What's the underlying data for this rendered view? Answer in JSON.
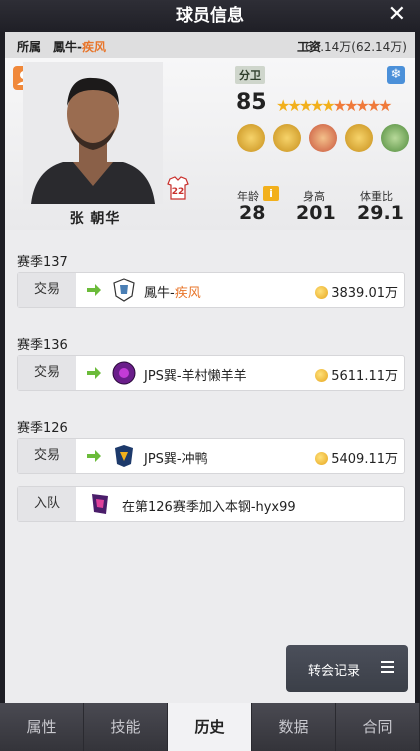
{
  "window": {
    "title": "球员信息"
  },
  "info": {
    "affiliation_label": "所属",
    "team_main": "鳳牛-",
    "team_sub": "疾风",
    "salary_label": "工资",
    "salary_value": "62.14万(62.14万)"
  },
  "player": {
    "name": "张 朝华",
    "position": "分卫",
    "overall": "85",
    "star_rating": 5,
    "jersey_number": "22",
    "stats": [
      {
        "label": "年龄",
        "value": "28"
      },
      {
        "label": "身高",
        "value": "201"
      },
      {
        "label": "体重比",
        "value": "29.1"
      }
    ]
  },
  "history": [
    {
      "season": "赛季137",
      "entries": [
        {
          "kind": "交易",
          "team_main": "鳳牛-",
          "team_sub": "疾风",
          "fee": "3839.01万"
        }
      ]
    },
    {
      "season": "赛季136",
      "entries": [
        {
          "kind": "交易",
          "team_main": "JPS巽-羊村懒羊羊",
          "team_sub": "",
          "fee": "5611.11万"
        }
      ]
    },
    {
      "season": "赛季126",
      "entries": [
        {
          "kind": "交易",
          "team_main": "JPS巽-冲鸭",
          "team_sub": "",
          "fee": "5409.11万"
        },
        {
          "kind": "入队",
          "team_main": "在第126赛季加入本钢-hyx99",
          "team_sub": "",
          "fee": ""
        }
      ]
    }
  ],
  "transfer_button": {
    "label": "转会记录"
  },
  "tabs": [
    {
      "label": "属性",
      "active": false
    },
    {
      "label": "技能",
      "active": false
    },
    {
      "label": "历史",
      "active": true
    },
    {
      "label": "数据",
      "active": false
    },
    {
      "label": "合同",
      "active": false
    }
  ],
  "colors": {
    "accent": "#e8752a",
    "panel": "#ececee",
    "tab_bar": "#3e3e45"
  }
}
